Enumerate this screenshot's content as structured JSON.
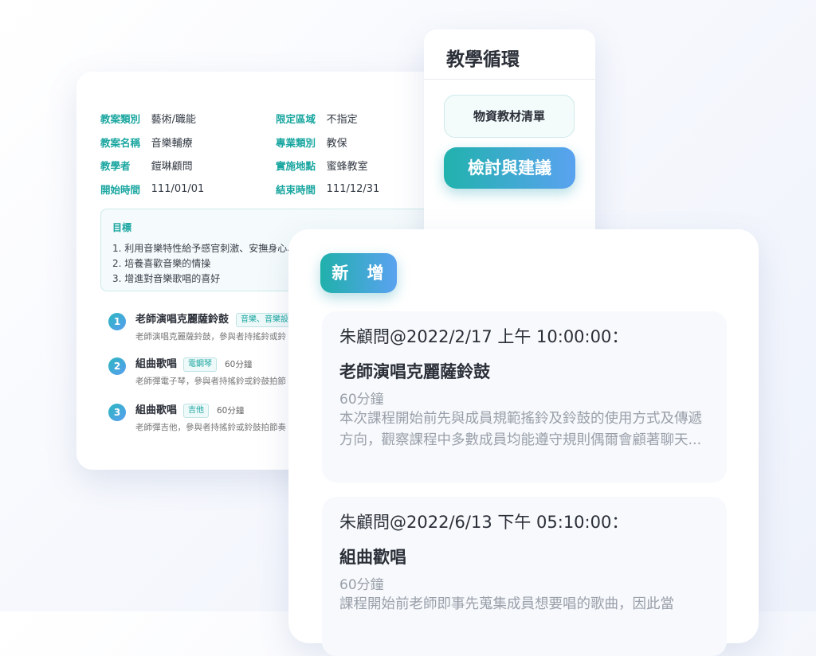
{
  "plan": {
    "info_rows": [
      {
        "l1": "教案類別",
        "v1": "藝術/職能",
        "l2": "限定區域",
        "v2": "不指定"
      },
      {
        "l1": "教案名稱",
        "v1": "音樂輔療",
        "l2": "專業類別",
        "v2": "教保"
      },
      {
        "l1": "教學者",
        "v1": "鎧琳顧問",
        "l2": "實施地點",
        "v2": "蜜蜂教室"
      },
      {
        "l1": "開始時間",
        "v1": "111/01/01",
        "l2": "結束時間",
        "v2": "111/12/31"
      }
    ],
    "goal": {
      "title": "目標",
      "items": [
        "1. 利用音樂特性給予感官刺激、安撫身心、",
        "2. 培養喜歡音樂的情操",
        "3. 增進對音樂歌唱的喜好"
      ]
    },
    "steps": [
      {
        "num": "1",
        "title": "老師演唱克麗薩鈴鼓",
        "tag": "音樂、音樂設",
        "duration": "",
        "desc": "老師演唱克麗薩鈴鼓，參與者持搖鈴或鈴"
      },
      {
        "num": "2",
        "title": "組曲歌唱",
        "tag": "電鋼琴",
        "duration": "60分鐘",
        "desc": "老師彈電子琴，參與者持搖鈴或鈴鼓拍節"
      },
      {
        "num": "3",
        "title": "組曲歌唱",
        "tag": "吉他",
        "duration": "60分鐘",
        "desc": "老師彈吉他，參與者持搖鈴或鈴鼓拍節奏"
      }
    ]
  },
  "cycle": {
    "title": "教學循環",
    "materials_label": "物資教材清單",
    "review_label": "檢討與建議"
  },
  "records": {
    "add_label": "新 增",
    "items": [
      {
        "head": "朱顧問@2022/2/17 上午 10:00:00：",
        "title": "老師演唱克麗薩鈴鼓",
        "duration": "60分鐘",
        "body": "本次課程開始前先與成員規範搖鈴及鈴鼓的使用方式及傳遞方向，觀察課程中多數成員均能遵守規則偶爾會顧著聊天..."
      },
      {
        "head": "朱顧問@2022/6/13 下午 05:10:00：",
        "title": "組曲歡唱",
        "duration": "60分鐘",
        "body": "課程開始前老師即事先蒐集成員想要唱的歌曲，因此當"
      }
    ]
  },
  "colors": {
    "accent": "#1aa6a0",
    "gradient_start": "#21b2ad",
    "gradient_end": "#5aa2f0"
  }
}
